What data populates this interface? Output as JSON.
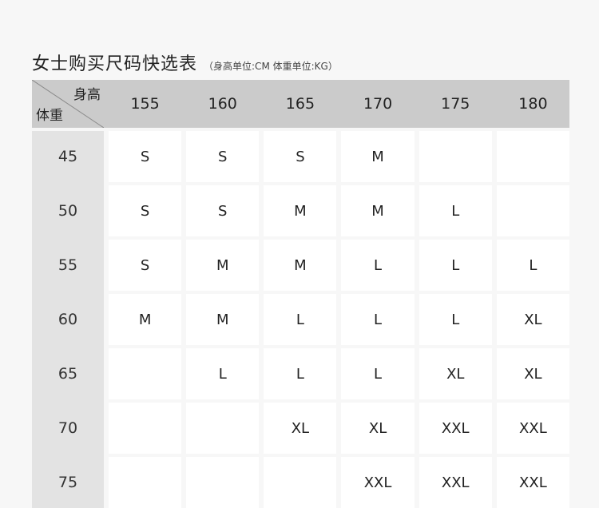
{
  "title": "女士购买尺码快选表",
  "units": "（身高单位:CM  体重单位:KG）",
  "corner": {
    "height_label": "身高",
    "weight_label": "体重"
  },
  "heights": [
    "155",
    "160",
    "165",
    "170",
    "175",
    "180"
  ],
  "rows": [
    {
      "weight": "45",
      "sizes": [
        "S",
        "S",
        "S",
        "M",
        "",
        ""
      ]
    },
    {
      "weight": "50",
      "sizes": [
        "S",
        "S",
        "M",
        "M",
        "L",
        ""
      ]
    },
    {
      "weight": "55",
      "sizes": [
        "S",
        "M",
        "M",
        "L",
        "L",
        "L"
      ]
    },
    {
      "weight": "60",
      "sizes": [
        "M",
        "M",
        "L",
        "L",
        "L",
        "XL"
      ]
    },
    {
      "weight": "65",
      "sizes": [
        "",
        "L",
        "L",
        "L",
        "XL",
        "XL"
      ]
    },
    {
      "weight": "70",
      "sizes": [
        "",
        "",
        "XL",
        "XL",
        "XXL",
        "XXL"
      ]
    },
    {
      "weight": "75",
      "sizes": [
        "",
        "",
        "",
        "XXL",
        "XXL",
        "XXL"
      ]
    }
  ],
  "colors": {
    "header_bg": "#cbcbcb",
    "side_bg": "#e3e3e3",
    "cell_bg": "#ffffff",
    "page_bg": "#f7f7f7"
  }
}
